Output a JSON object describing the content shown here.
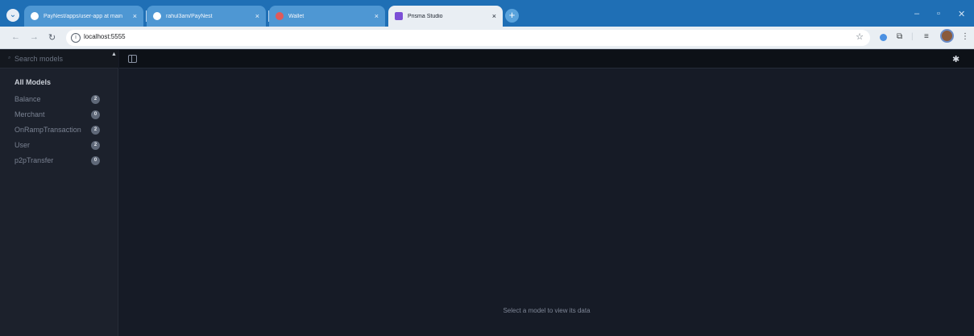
{
  "browser": {
    "tabs": [
      {
        "title": "PayNest/apps/user-app at main",
        "favicon_color": "#ffffff"
      },
      {
        "title": "rahul3am/PayNest",
        "favicon_color": "#ffffff"
      },
      {
        "title": "Wallet",
        "favicon_color": "#e05a5a"
      },
      {
        "title": "Prisma Studio",
        "favicon_color": "#7b4fd6"
      }
    ],
    "new_tab_label": "+",
    "tab_close_label": "×",
    "search_tabs_icon": "⌄",
    "window_controls": [
      "–",
      "▫",
      "✕"
    ],
    "address": "localhost:5555",
    "nav": {
      "back": "←",
      "forward": "→",
      "reload": "↻"
    },
    "toolbar_icons": {
      "star": "☆",
      "extensions": "⧉",
      "media": "≡",
      "menu": "⋮"
    }
  },
  "sidebar": {
    "search_placeholder": "Search models",
    "section_title": "All Models",
    "models": [
      {
        "name": "Balance",
        "count": "2"
      },
      {
        "name": "Merchant",
        "count": "0"
      },
      {
        "name": "OnRampTransaction",
        "count": "2"
      },
      {
        "name": "User",
        "count": "2"
      },
      {
        "name": "p2pTransfer",
        "count": "0"
      }
    ]
  },
  "main": {
    "empty_message": "Select a model to view its data"
  }
}
